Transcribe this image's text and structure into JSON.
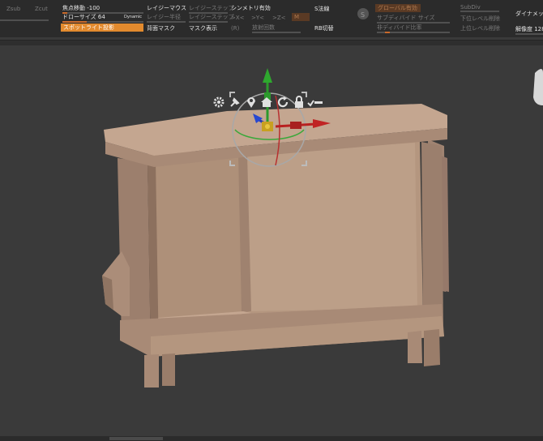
{
  "toolbar": {
    "zsub_label": "Zsub",
    "zcut_label": "Zcut",
    "focal_shift": "焦点移動 -100",
    "draw_size": "ドローサイズ 64",
    "dynamic_label": "Dynamic",
    "spotlight_button": "スポットライト投影",
    "lazy_mouse": "レイジーマウス",
    "lazy_step": "レイジーステップ",
    "lazy_radius": "レイジー半径",
    "lazy_step2": "レイジーステップ",
    "back_mask": "背面マスク",
    "symmetry": "シンメトリ有効",
    "sym_x": ">X<",
    "sym_y": ">Y<",
    "sym_z": ">Z<",
    "sym_m": "M",
    "mask_display": "マスク表示",
    "sym_r": "(R)",
    "radial_count": "放射回数",
    "s_normal": "S法線",
    "rb_switch": "RB切替",
    "global_enable": "グローバル有効",
    "subdivide_size": "サブディバイド サイズ",
    "subdivide_ratio": "非ディバイド比率",
    "subdiv_label": "SubDiv",
    "lower_level_delete": "下位レベル削除",
    "higher_level_delete": "上位レベル削除",
    "dynamic_right": "ダイナメッシ",
    "resolution": "解像度 128"
  },
  "colors": {
    "toolbar_bg": "#2b2b2b",
    "viewport_bg": "#3a3a3a",
    "accent_orange": "#e28a2e",
    "model_color": "#a88b76"
  },
  "viewport_icons": [
    "gear-icon",
    "pin-icon",
    "location-icon",
    "home-icon",
    "rotate-icon",
    "lock-icon",
    "toggle-icon"
  ]
}
